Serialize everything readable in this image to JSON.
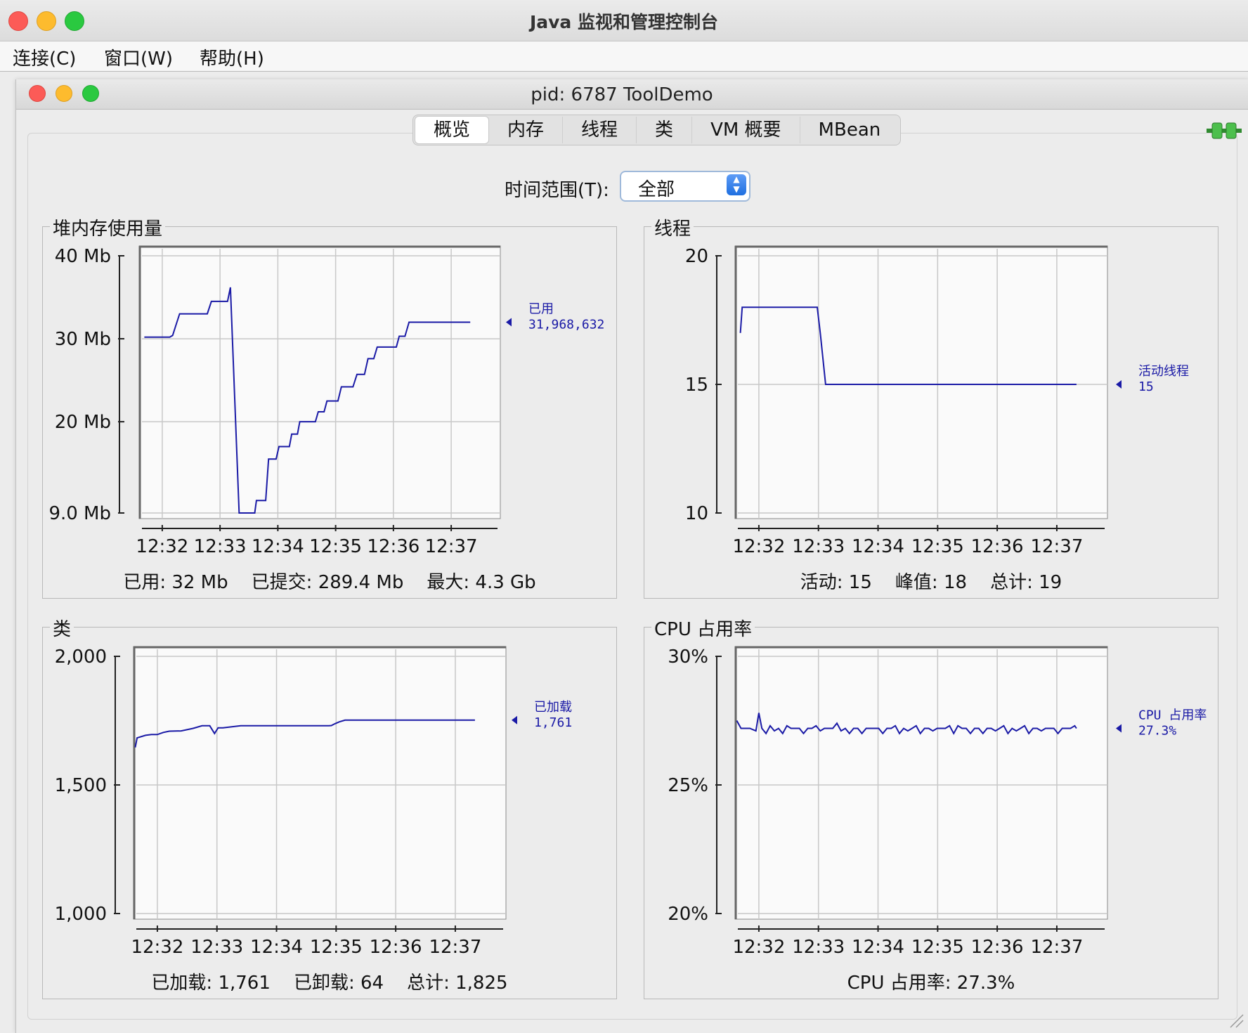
{
  "window": {
    "title": "Java 监视和管理控制台"
  },
  "menu": [
    {
      "label": "连接(C)"
    },
    {
      "label": "窗口(W)"
    },
    {
      "label": "帮助(H)"
    }
  ],
  "inner": {
    "title": "pid: 6787 ToolDemo"
  },
  "tabs": [
    {
      "label": "概览",
      "active": true
    },
    {
      "label": "内存"
    },
    {
      "label": "线程"
    },
    {
      "label": "类"
    },
    {
      "label": "VM 概要"
    },
    {
      "label": "MBean"
    }
  ],
  "time_range": {
    "label": "时间范围(T):",
    "value": "全部"
  },
  "colors": {
    "series": "#1a1aa6",
    "grid": "#c8c8c8",
    "plot_bg": "#fafafa"
  },
  "panels": {
    "heap": {
      "title": "堆内存使用量",
      "stats": "已用: 32 Mb    已提交: 289.4 Mb    最大: 4.3 Gb",
      "legend": {
        "name": "已用",
        "value": "31,968,632"
      }
    },
    "threads": {
      "title": "线程",
      "stats": "活动: 15    峰值: 18    总计: 19",
      "legend": {
        "name": "活动线程",
        "value": "15"
      }
    },
    "classes": {
      "title": "类",
      "stats": "已加载: 1,761    已卸载: 64    总计: 1,825",
      "legend": {
        "name": "已加载",
        "value": "1,761"
      }
    },
    "cpu": {
      "title": "CPU 占用率",
      "stats": "CPU 占用率: 27.3%",
      "legend": {
        "name": "CPU 占用率",
        "value": "27.3%"
      }
    }
  },
  "chart_data": [
    {
      "type": "line",
      "title": "堆内存使用量",
      "xticks": [
        "12:32",
        "12:33",
        "12:34",
        "12:35",
        "12:36",
        "12:37"
      ],
      "yticks": [
        "9.0 Mb",
        "20 Mb",
        "30 Mb",
        "40 Mb"
      ],
      "ytick_values": [
        9.0,
        20,
        30,
        40
      ],
      "ylim": [
        9.0,
        40
      ],
      "x_minutes_range": [
        31.6,
        37.85
      ],
      "grid": true,
      "series": [
        {
          "name": "已用",
          "x": [
            31.69,
            31.85,
            31.88,
            31.92,
            32.13,
            32.18,
            32.24,
            32.3,
            32.38,
            32.4,
            32.42,
            32.5,
            32.53,
            32.56,
            32.6,
            32.72,
            32.74,
            32.78,
            32.85,
            32.88,
            32.94,
            33.13,
            33.18,
            33.33,
            33.36,
            33.45,
            33.5,
            33.6,
            33.63,
            33.79,
            33.84,
            33.97,
            34.02,
            34.2,
            34.24,
            34.34,
            34.38,
            34.65,
            34.7,
            34.8,
            34.85,
            35.04,
            35.1,
            35.3,
            35.37,
            35.5,
            35.56,
            35.66,
            35.72,
            36.05,
            36.1,
            36.2,
            36.27,
            36.55,
            36.6,
            36.68,
            36.78,
            36.97,
            37.0,
            37.06,
            37.12,
            37.2,
            37.26,
            37.29,
            37.33
          ],
          "y": [
            30.2,
            30.2,
            30.2,
            30.2,
            30.2,
            30.4,
            31.7,
            33.0,
            33.0,
            33.0,
            33.0,
            33.0,
            33.0,
            33.0,
            33.0,
            33.0,
            33.0,
            33.0,
            34.5,
            34.5,
            34.5,
            34.5,
            36.2,
            9.0,
            9.0,
            9.0,
            9.0,
            9.0,
            10.5,
            10.5,
            15.5,
            15.5,
            17.0,
            17.0,
            18.5,
            18.5,
            20.0,
            20.0,
            21.2,
            21.2,
            22.5,
            22.5,
            24.2,
            24.2,
            25.7,
            25.7,
            27.6,
            27.6,
            29.0,
            29.0,
            30.3,
            30.3,
            32.0,
            32.0,
            32.0,
            32.0,
            32.0,
            32.0,
            32.0,
            32.0,
            32.0,
            32.0,
            32.0,
            32.0,
            32.0
          ]
        }
      ]
    },
    {
      "type": "line",
      "title": "线程",
      "xticks": [
        "12:32",
        "12:33",
        "12:34",
        "12:35",
        "12:36",
        "12:37"
      ],
      "yticks": [
        "10",
        "15",
        "20"
      ],
      "ytick_values": [
        10,
        15,
        20
      ],
      "ylim": [
        10,
        20
      ],
      "x_minutes_range": [
        31.6,
        37.85
      ],
      "grid": true,
      "series": [
        {
          "name": "活动线程",
          "x": [
            31.69,
            31.72,
            32.98,
            33.03,
            33.12,
            37.33
          ],
          "y": [
            17,
            18,
            18,
            17,
            15,
            15
          ]
        }
      ]
    },
    {
      "type": "line",
      "title": "类",
      "xticks": [
        "12:32",
        "12:33",
        "12:34",
        "12:35",
        "12:36",
        "12:37"
      ],
      "yticks": [
        "1,000",
        "1,500",
        "2,000"
      ],
      "ytick_values": [
        1000,
        1500,
        2000
      ],
      "ylim": [
        1000,
        2000
      ],
      "x_minutes_range": [
        31.6,
        37.85
      ],
      "grid": true,
      "series": [
        {
          "name": "已加载",
          "x": [
            31.63,
            31.66,
            31.8,
            31.9,
            32.0,
            32.1,
            32.2,
            32.4,
            32.6,
            32.75,
            32.88,
            32.96,
            33.02,
            33.1,
            33.4,
            33.6,
            34.0,
            34.5,
            34.88,
            34.92,
            34.98,
            35.05,
            35.15,
            35.3,
            35.6,
            36.0,
            36.5,
            37.0,
            37.33
          ],
          "y": [
            1646,
            1683,
            1693,
            1696,
            1696,
            1704,
            1709,
            1710,
            1720,
            1730,
            1730,
            1700,
            1722,
            1722,
            1730,
            1730,
            1730,
            1730,
            1730,
            1731,
            1738,
            1745,
            1752,
            1752,
            1752,
            1752,
            1752,
            1752,
            1752
          ]
        }
      ]
    },
    {
      "type": "line",
      "title": "CPU 占用率",
      "xticks": [
        "12:32",
        "12:33",
        "12:34",
        "12:35",
        "12:36",
        "12:37"
      ],
      "yticks": [
        "20%",
        "25%",
        "30%"
      ],
      "ytick_values": [
        20,
        25,
        30
      ],
      "ylim": [
        20,
        30
      ],
      "x_minutes_range": [
        31.6,
        37.85
      ],
      "grid": true,
      "series": [
        {
          "name": "CPU 占用率",
          "x": [
            31.63,
            31.7,
            31.85,
            31.95,
            32.0,
            32.05,
            32.12,
            32.19,
            32.26,
            32.33,
            32.4,
            32.47,
            32.54,
            32.61,
            32.68,
            32.75,
            32.82,
            32.89,
            32.96,
            33.03,
            33.1,
            33.17,
            33.24,
            33.31,
            33.38,
            33.45,
            33.52,
            33.59,
            33.66,
            33.73,
            33.8,
            33.87,
            33.94,
            34.01,
            34.08,
            34.15,
            34.22,
            34.29,
            34.36,
            34.43,
            34.5,
            34.57,
            34.64,
            34.71,
            34.78,
            34.85,
            34.92,
            34.99,
            35.06,
            35.13,
            35.2,
            35.27,
            35.34,
            35.41,
            35.48,
            35.55,
            35.62,
            35.69,
            35.76,
            35.83,
            35.9,
            35.97,
            36.04,
            36.11,
            36.18,
            36.25,
            36.32,
            36.39,
            36.46,
            36.53,
            36.6,
            36.67,
            36.74,
            36.81,
            36.88,
            36.95,
            37.02,
            37.09,
            37.16,
            37.23,
            37.3,
            37.33
          ],
          "y": [
            27.5,
            27.2,
            27.2,
            27.1,
            27.8,
            27.2,
            27.0,
            27.3,
            27.1,
            27.2,
            27.0,
            27.3,
            27.2,
            27.2,
            27.2,
            27.0,
            27.2,
            27.2,
            27.3,
            27.1,
            27.2,
            27.2,
            27.2,
            27.4,
            27.1,
            27.2,
            27.0,
            27.2,
            27.2,
            27.0,
            27.2,
            27.2,
            27.2,
            27.2,
            27.0,
            27.2,
            27.2,
            27.3,
            27.0,
            27.2,
            27.1,
            27.2,
            27.3,
            27.0,
            27.2,
            27.2,
            27.1,
            27.2,
            27.2,
            27.2,
            27.3,
            27.0,
            27.3,
            27.2,
            27.2,
            27.0,
            27.2,
            27.2,
            27.0,
            27.2,
            27.2,
            27.1,
            27.2,
            27.3,
            27.0,
            27.2,
            27.1,
            27.2,
            27.3,
            27.0,
            27.2,
            27.2,
            27.1,
            27.2,
            27.2,
            27.2,
            27.0,
            27.2,
            27.2,
            27.2,
            27.3,
            27.2
          ]
        }
      ]
    }
  ]
}
